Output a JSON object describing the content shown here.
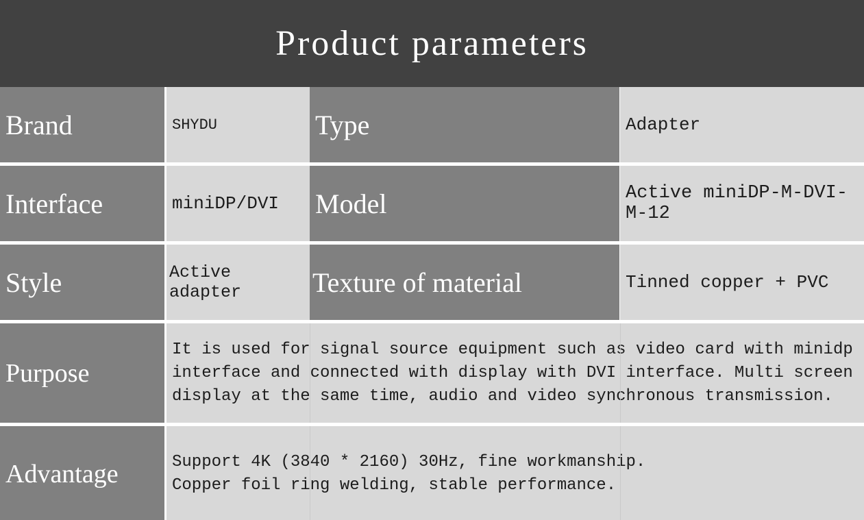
{
  "header": {
    "title": "Product parameters"
  },
  "table": {
    "rows": [
      {
        "label1": "Brand",
        "value1": "SHYDU",
        "label2": "Type",
        "value2": "Adapter"
      },
      {
        "label1": "Interface",
        "value1": "miniDP/DVI",
        "label2": "Model",
        "value2": "Active miniDP-M-DVI-M-12"
      },
      {
        "label1": "Style",
        "value1": "Active adapter",
        "label2": "Texture of material",
        "value2": "Tinned copper + PVC"
      },
      {
        "label1": "Purpose",
        "value1": "It is used for signal source equipment such as video card with minidp interface and connected with display with DVI interface. Multi screen display at the same time, audio and video synchronous transmission."
      },
      {
        "label1": "Advantage",
        "value1": "Support 4K (3840 * 2160) 30Hz, fine workmanship.\nCopper foil ring welding, stable performance."
      }
    ]
  },
  "colors": {
    "header_bg": "#414141",
    "label_bg": "#808080",
    "value_bg": "#d8d8d8",
    "label_text": "#ffffff",
    "value_text": "#1c1c1c",
    "page_bg": "#ffffff"
  }
}
